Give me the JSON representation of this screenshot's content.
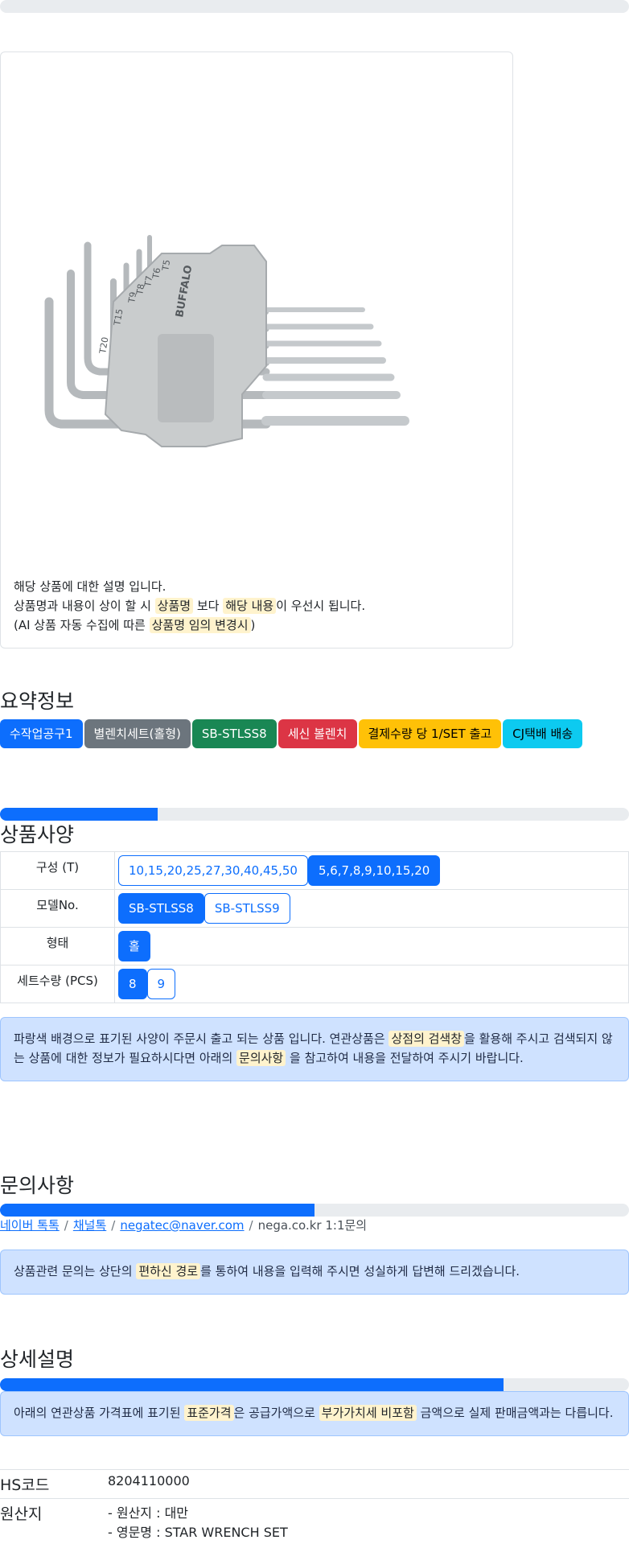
{
  "product": {
    "image_alt": "BUFFALO star wrench set",
    "image_markings": [
      "BUFFALO",
      "T5",
      "T6",
      "T7",
      "T8",
      "T9",
      "T15",
      "T20"
    ],
    "notice_line1": "해당 상품에 대한 설명 입니다.",
    "notice_line2_a": "상품명과 내용이 상이 할 시",
    "notice_line2_mark1": "상품명",
    "notice_line2_b": "보다",
    "notice_line2_mark2": "해당 내용",
    "notice_line2_c": "이 우선시 됩니다.",
    "notice_line3_a": "(AI 상품 자동 수집에 따른",
    "notice_line3_mark": "상품명 임의 변경시",
    "notice_line3_b": ")"
  },
  "summary": {
    "title": "요약정보",
    "badges": [
      {
        "label": "수작업공구1",
        "color": "#0d6efd",
        "text": "#ffffff"
      },
      {
        "label": "별렌치세트(홀형)",
        "color": "#6c757d",
        "text": "#ffffff"
      },
      {
        "label": "SB-STLSS8",
        "color": "#198754",
        "text": "#ffffff"
      },
      {
        "label": "세신 볼렌치",
        "color": "#dc3545",
        "text": "#ffffff"
      },
      {
        "label": "결제수량 당 1/SET 출고",
        "color": "#ffc107",
        "text": "#000000"
      },
      {
        "label": "CJ택배 배송",
        "color": "#0dcaf0",
        "text": "#000000"
      }
    ]
  },
  "spec": {
    "progress": 25,
    "title": "상품사양",
    "rows": [
      {
        "label": "구성 (T)",
        "options": [
          {
            "label": "10,15,20,25,27,30,40,45,50",
            "selected": false
          },
          {
            "label": "5,6,7,8,9,10,15,20",
            "selected": true
          }
        ]
      },
      {
        "label": "모델No.",
        "options": [
          {
            "label": "SB-STLSS8",
            "selected": true
          },
          {
            "label": "SB-STLSS9",
            "selected": false
          }
        ]
      },
      {
        "label": "형태",
        "options": [
          {
            "label": "홀",
            "selected": true
          }
        ]
      },
      {
        "label": "세트수량 (PCS)",
        "options": [
          {
            "label": "8",
            "selected": true
          },
          {
            "label": "9",
            "selected": false
          }
        ]
      }
    ],
    "notice_a": "파랑색 배경으로 표기된 사양이 주문시 출고 되는 상품 입니다. 연관상품은",
    "notice_mark1": "상점의 검색창",
    "notice_b": "을 활용해 주시고 검색되지 않는 상품에 대한 정보가 필요하시다면 아래의",
    "notice_mark2": "문의사항",
    "notice_c": "을 참고하여 내용을 전달하여 주시기 바랍니다."
  },
  "inquiry": {
    "title": "문의사항",
    "progress": 50,
    "links": [
      "네이버 톡톡",
      "채널톡",
      "negatec@naver.com"
    ],
    "last": "nega.co.kr 1:1문의",
    "separator": "/",
    "notice_a": "상품관련 문의는 상단의",
    "notice_mark": "편하신 경로",
    "notice_b": "를 통하여 내용을 입력해 주시면 성실하게 답변해 드리겠습니다."
  },
  "detail": {
    "title": "상세설명",
    "progress": 80,
    "notice_a": "아래의 연관상품 가격표에 표기된",
    "notice_mark1": "표준가격",
    "notice_b": "은 공급가액으로",
    "notice_mark2": "부가가치세 비포함",
    "notice_c": "금액으로 실제 판매금액과는 다릅니다.",
    "hs_label": "HS코드",
    "hs_value": "8204110000",
    "origin_label": "원산지",
    "origin_line1": "- 원산지 : 대만",
    "origin_line2": "- 영문명 : STAR WRENCH SET"
  }
}
